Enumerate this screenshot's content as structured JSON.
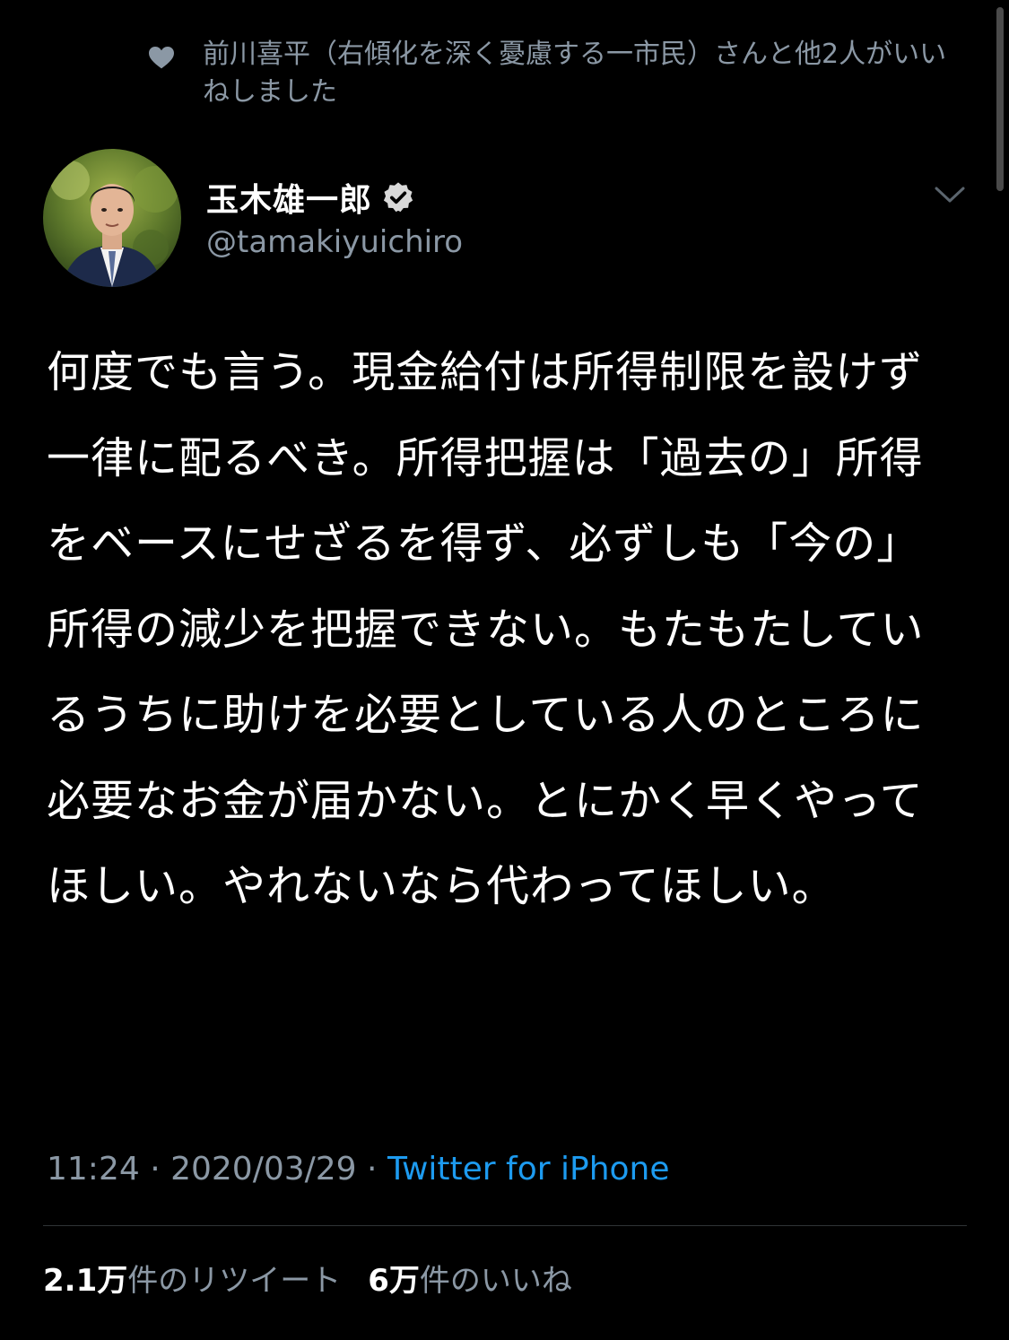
{
  "social_context": {
    "text": "前川喜平（右傾化を深く憂慮する一市民）さんと他2人がいいねしました",
    "icon": "heart-icon"
  },
  "author": {
    "name": "玉木雄一郎",
    "handle": "@tamakiyuichiro",
    "verified": true
  },
  "tweet": {
    "text": "何度でも言う。現金給付は所得制限を設けず一律に配るべき。所得把握は「過去の」所得をベースにせざるを得ず、必ずしも「今の」所得の減少を把握できない。もたもたしているうちに助けを必要としている人のところに必要なお金が届かない。とにかく早くやってほしい。やれないなら代わってほしい。"
  },
  "meta": {
    "time": "11:24",
    "separator": " · ",
    "date": "2020/03/29",
    "source": "Twitter for iPhone"
  },
  "stats": {
    "retweets_count": "2.1万",
    "retweets_label": "件のリツイート",
    "likes_count": "6万",
    "likes_label": "件のいいね"
  },
  "colors": {
    "background": "#000000",
    "text_primary": "#ffffff",
    "text_secondary": "#8b98a5",
    "link": "#1d9bf0",
    "divider": "#2f3336"
  }
}
